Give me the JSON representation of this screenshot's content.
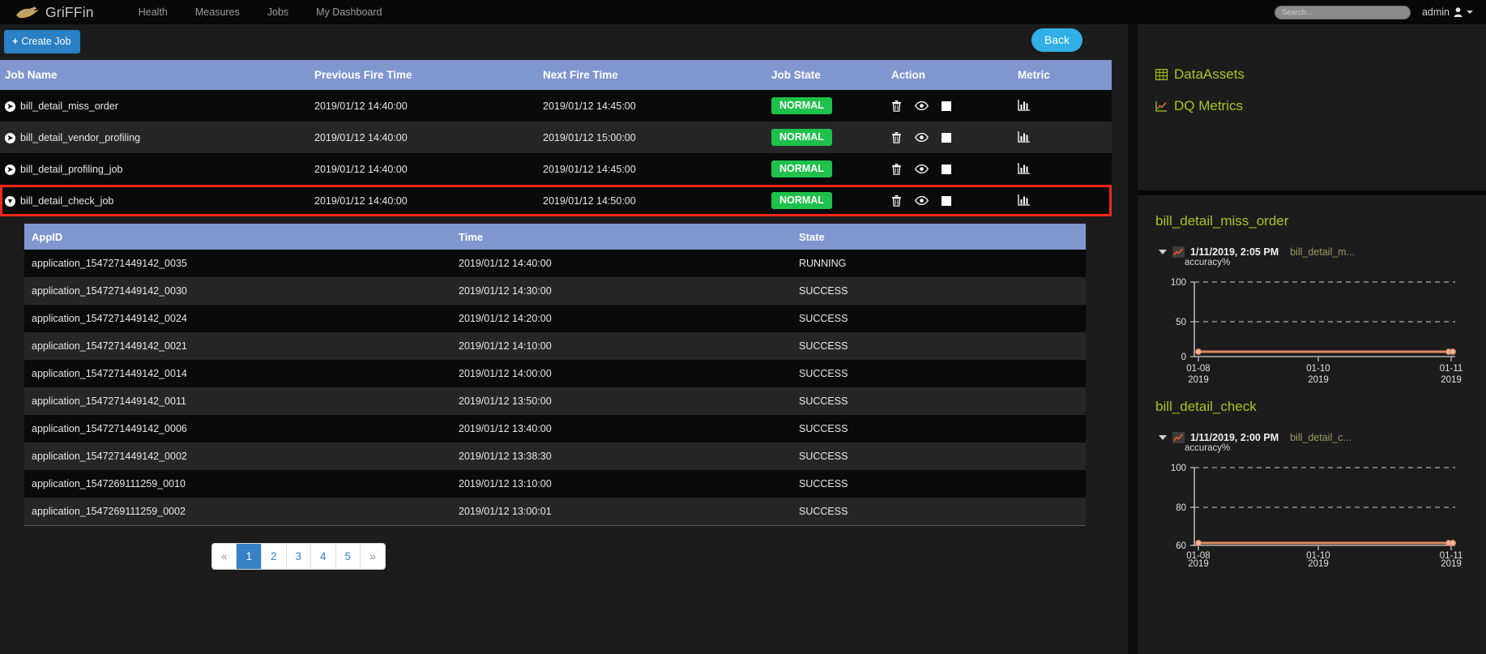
{
  "navbar": {
    "brand": "GriFFin",
    "brand_logo_icon": "griffin-logo-icon",
    "links": [
      {
        "label": "Health",
        "name": "nav-link-health"
      },
      {
        "label": "Measures",
        "name": "nav-link-measures"
      },
      {
        "label": "Jobs",
        "name": "nav-link-jobs"
      },
      {
        "label": "My Dashboard",
        "name": "nav-link-my-dashboard"
      }
    ],
    "search": {
      "value": "",
      "placeholder": "Search..."
    },
    "user": "admin",
    "user_icon": "user-icon",
    "caret_icon": "chevron-down-icon"
  },
  "toolbar": {
    "create_label": "Create Job",
    "create_plus": "+",
    "back_label": "Back"
  },
  "jobs_table": {
    "columns": [
      "Job Name",
      "Previous Fire Time",
      "Next Fire Time",
      "Job State",
      "Action",
      "Metric"
    ],
    "rows": [
      {
        "name": "bill_detail_miss_order",
        "previous_fire_time": "2019/01/12 14:40:00",
        "next_fire_time": "2019/01/12 14:45:00",
        "state": "NORMAL",
        "expand_icon": "chevron-right-circle-icon",
        "expanded": false
      },
      {
        "name": "bill_detail_vendor_profiling",
        "previous_fire_time": "2019/01/12 14:40:00",
        "next_fire_time": "2019/01/12 15:00:00",
        "state": "NORMAL",
        "expand_icon": "chevron-right-circle-icon",
        "expanded": false
      },
      {
        "name": "bill_detail_profiling_job",
        "previous_fire_time": "2019/01/12 14:40:00",
        "next_fire_time": "2019/01/12 14:45:00",
        "state": "NORMAL",
        "expand_icon": "chevron-right-circle-icon",
        "expanded": false
      },
      {
        "name": "bill_detail_check_job",
        "previous_fire_time": "2019/01/12 14:40:00",
        "next_fire_time": "2019/01/12 14:50:00",
        "state": "NORMAL",
        "expand_icon": "chevron-down-circle-icon",
        "expanded": true
      }
    ],
    "action_icons": [
      "trash-icon",
      "eye-icon",
      "stop-square-icon"
    ],
    "metric_icon": "bar-chart-icon",
    "state_badge_color": "#1fc14b",
    "header_color": "#8096cf",
    "highlight_color": "#f7261b"
  },
  "app_table": {
    "columns": [
      "AppID",
      "Time",
      "State"
    ],
    "rows": [
      {
        "appid": "application_1547271449142_0035",
        "time": "2019/01/12 14:40:00",
        "state": "RUNNING"
      },
      {
        "appid": "application_1547271449142_0030",
        "time": "2019/01/12 14:30:00",
        "state": "SUCCESS"
      },
      {
        "appid": "application_1547271449142_0024",
        "time": "2019/01/12 14:20:00",
        "state": "SUCCESS"
      },
      {
        "appid": "application_1547271449142_0021",
        "time": "2019/01/12 14:10:00",
        "state": "SUCCESS"
      },
      {
        "appid": "application_1547271449142_0014",
        "time": "2019/01/12 14:00:00",
        "state": "SUCCESS"
      },
      {
        "appid": "application_1547271449142_0011",
        "time": "2019/01/12 13:50:00",
        "state": "SUCCESS"
      },
      {
        "appid": "application_1547271449142_0006",
        "time": "2019/01/12 13:40:00",
        "state": "SUCCESS"
      },
      {
        "appid": "application_1547271449142_0002",
        "time": "2019/01/12 13:38:30",
        "state": "SUCCESS"
      },
      {
        "appid": "application_1547269111259_0010",
        "time": "2019/01/12 13:10:00",
        "state": "SUCCESS"
      },
      {
        "appid": "application_1547269111259_0002",
        "time": "2019/01/12 13:00:01",
        "state": "SUCCESS"
      }
    ]
  },
  "pagination": {
    "prev": "«",
    "next": "»",
    "pages": [
      "1",
      "2",
      "3",
      "4",
      "5"
    ],
    "active": "1"
  },
  "sidebar": {
    "links": [
      {
        "label": "DataAssets",
        "icon": "table-grid-icon",
        "name": "sidebar-link-dataassets"
      },
      {
        "label": "DQ Metrics",
        "icon": "line-chart-icon",
        "name": "sidebar-link-dq-metrics"
      }
    ],
    "link_color": "#a8c422",
    "charts": [
      {
        "title": "bill_detail_miss_order",
        "meta_date": "1/11/2019, 2:05 PM",
        "meta_name": "bill_detail_m...",
        "meta_icon": "line-chart-icon",
        "toggle_icon": "triangle-down-icon"
      },
      {
        "title": "bill_detail_check",
        "meta_date": "1/11/2019, 2:00 PM",
        "meta_name": "bill_detail_c...",
        "meta_icon": "line-chart-icon",
        "toggle_icon": "triangle-down-icon"
      }
    ]
  },
  "chart_data": [
    {
      "type": "line",
      "title": "bill_detail_miss_order",
      "ylabel": "accuracy%",
      "xlabel": "",
      "x": [
        "01-08\n2019",
        "01-10\n2019",
        "01-11\n2019"
      ],
      "xtick_labels": [
        [
          "01-08",
          "2019"
        ],
        [
          "01-10",
          "2019"
        ],
        [
          "01-11",
          "2019"
        ]
      ],
      "ytick_labels": [
        "0",
        "50",
        "100"
      ],
      "ylim": [
        0,
        100
      ],
      "grid": true,
      "legend": false,
      "series": [
        {
          "name": "accuracy%",
          "color": "#e08a66",
          "points": [
            {
              "x": "01-08 2019",
              "y": 6
            },
            {
              "x": "01-11 2019",
              "y": 6
            }
          ]
        }
      ]
    },
    {
      "type": "line",
      "title": "bill_detail_check",
      "ylabel": "accuracy%",
      "xlabel": "",
      "x": [
        "01-08\n2019",
        "01-10\n2019",
        "01-11\n2019"
      ],
      "xtick_labels": [
        [
          "01-08",
          "2019"
        ],
        [
          "01-10",
          "2019"
        ],
        [
          "01-11",
          "2019"
        ]
      ],
      "ytick_labels": [
        "60",
        "80",
        "100"
      ],
      "ylim": [
        60,
        100
      ],
      "grid": true,
      "legend": false,
      "series": [
        {
          "name": "accuracy%",
          "color": "#e08a66",
          "points": [
            {
              "x": "01-08 2019",
              "y": 61.3
            },
            {
              "x": "01-11 2019",
              "y": 61.3
            }
          ]
        }
      ]
    }
  ]
}
